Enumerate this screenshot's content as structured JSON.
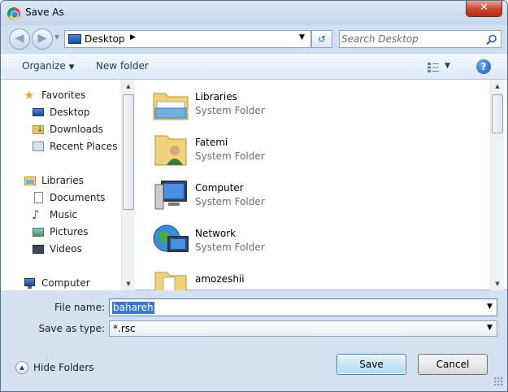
{
  "window": {
    "title": "Save As",
    "close_glyph": "✕"
  },
  "navigation": {
    "back_glyph": "◀",
    "forward_glyph": "▶",
    "address": "Desktop",
    "search_placeholder": "Search Desktop"
  },
  "toolbar": {
    "organize_label": "Organize",
    "new_folder_label": "New folder",
    "help_glyph": "?"
  },
  "nav_pane": {
    "favorites": {
      "label": "Favorites",
      "items": [
        "Desktop",
        "Downloads",
        "Recent Places"
      ]
    },
    "libraries": {
      "label": "Libraries",
      "items": [
        "Documents",
        "Music",
        "Pictures",
        "Videos"
      ]
    },
    "computer": {
      "label": "Computer"
    }
  },
  "files": [
    {
      "name": "Libraries",
      "type": "System Folder"
    },
    {
      "name": "Fatemi",
      "type": "System Folder"
    },
    {
      "name": "Computer",
      "type": "System Folder"
    },
    {
      "name": "Network",
      "type": "System Folder"
    },
    {
      "name": "amozeshii",
      "type": ""
    }
  ],
  "form": {
    "file_name_label": "File name:",
    "file_name_value": "bahareh",
    "save_type_label": "Save as type:",
    "save_type_value": "*.rsc"
  },
  "footer": {
    "hide_folders_label": "Hide Folders",
    "save_label": "Save",
    "cancel_label": "Cancel"
  },
  "colors": {
    "accent": "#3b78d6",
    "window_frame": "#cfe0f1",
    "close_red": "#c7452f"
  }
}
